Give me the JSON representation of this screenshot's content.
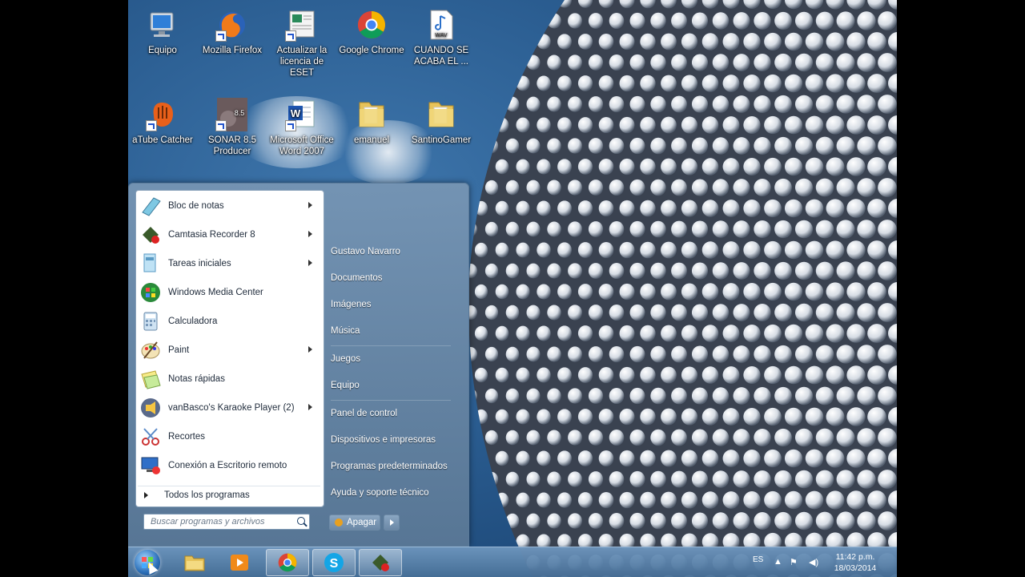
{
  "desktop": {
    "icons": [
      {
        "label": "Equipo"
      },
      {
        "label": "Mozilla Firefox"
      },
      {
        "label": "Actualizar la licencia de ESET"
      },
      {
        "label": "Google Chrome"
      },
      {
        "label": "CUANDO SE ACABA EL ..."
      },
      {
        "label": "aTube Catcher"
      },
      {
        "label": "SONAR 8.5 Producer"
      },
      {
        "label": "Microsoft Office Word 2007"
      },
      {
        "label": "emanuel"
      },
      {
        "label": "SantinoGamer"
      }
    ],
    "wav_badge": "WAV",
    "sonar_badge": "8.5"
  },
  "start_menu": {
    "programs": [
      {
        "label": "Bloc de notas",
        "submenu": true
      },
      {
        "label": "Camtasia Recorder 8",
        "submenu": true
      },
      {
        "label": "Tareas iniciales",
        "submenu": true
      },
      {
        "label": "Windows Media Center",
        "submenu": false
      },
      {
        "label": "Calculadora",
        "submenu": false
      },
      {
        "label": "Paint",
        "submenu": true
      },
      {
        "label": "Notas rápidas",
        "submenu": false
      },
      {
        "label": "vanBasco's Karaoke Player (2)",
        "submenu": true
      },
      {
        "label": "Recortes",
        "submenu": false
      },
      {
        "label": "Conexión a Escritorio remoto",
        "submenu": false
      }
    ],
    "all_programs": "Todos los programas",
    "search_placeholder": "Buscar programas y archivos",
    "right_links": [
      "Gustavo Navarro",
      "Documentos",
      "Imágenes",
      "Música",
      "Juegos",
      "Equipo",
      "Panel de control",
      "Dispositivos e impresoras",
      "Programas predeterminados",
      "Ayuda y soporte técnico"
    ],
    "shutdown_label": "Apagar"
  },
  "taskbar": {
    "language": "ES",
    "time": "11:42 p.m.",
    "date": "18/03/2014"
  }
}
